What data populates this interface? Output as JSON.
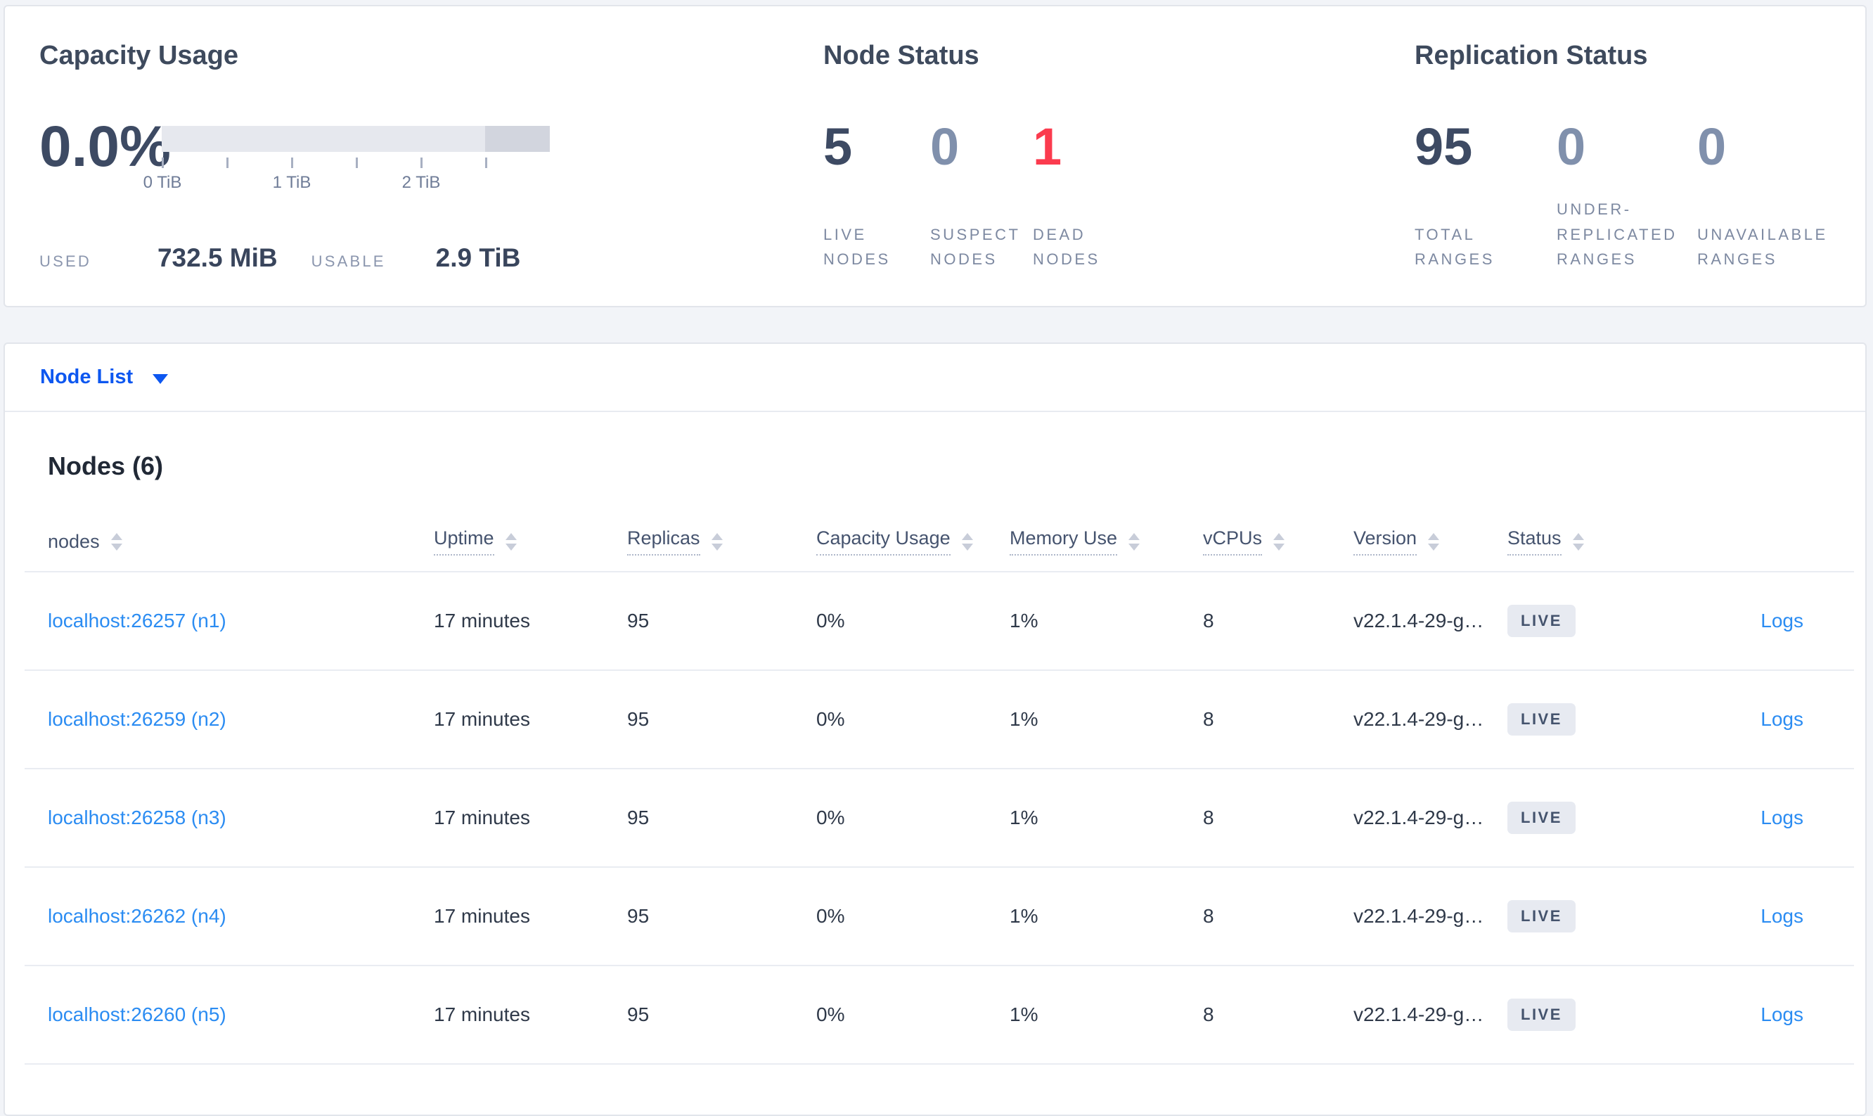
{
  "summary": {
    "capacity": {
      "title": "Capacity Usage",
      "percent": "0.0%",
      "tick_labels": [
        "0 TiB",
        "1 TiB",
        "2 TiB"
      ],
      "used_label": "USED",
      "used_value": "732.5 MiB",
      "usable_label": "USABLE",
      "usable_value": "2.9 TiB"
    },
    "node_status": {
      "title": "Node Status",
      "stats": [
        {
          "value": "5",
          "label": "LIVE NODES",
          "tone": "dark"
        },
        {
          "value": "0",
          "label": "SUSPECT NODES",
          "tone": "muted"
        },
        {
          "value": "1",
          "label": "DEAD NODES",
          "tone": "danger"
        }
      ]
    },
    "replication": {
      "title": "Replication Status",
      "stats": [
        {
          "value": "95",
          "label": "TOTAL RANGES",
          "tone": "dark"
        },
        {
          "value": "0",
          "label": "UNDER-REPLICATED RANGES",
          "tone": "muted"
        },
        {
          "value": "0",
          "label": "UNAVAILABLE RANGES",
          "tone": "muted"
        }
      ]
    }
  },
  "node_list": {
    "label": "Node List"
  },
  "nodes_section": {
    "heading": "Nodes (6)"
  },
  "table": {
    "columns": [
      {
        "key": "address",
        "label": "nodes",
        "underline": false,
        "sortable": true
      },
      {
        "key": "uptime",
        "label": "Uptime",
        "underline": true,
        "sortable": true
      },
      {
        "key": "replicas",
        "label": "Replicas",
        "underline": true,
        "sortable": true
      },
      {
        "key": "capacity",
        "label": "Capacity Usage",
        "underline": true,
        "sortable": true
      },
      {
        "key": "memory",
        "label": "Memory Use",
        "underline": true,
        "sortable": true
      },
      {
        "key": "vcpus",
        "label": "vCPUs",
        "underline": true,
        "sortable": true
      },
      {
        "key": "version",
        "label": "Version",
        "underline": true,
        "sortable": true
      },
      {
        "key": "status",
        "label": "Status",
        "underline": true,
        "sortable": true
      },
      {
        "key": "logs",
        "label": "",
        "underline": false,
        "sortable": false
      }
    ],
    "rows": [
      {
        "address": "localhost:26257 (n1)",
        "uptime": "17 minutes",
        "replicas": "95",
        "capacity": "0%",
        "memory": "1%",
        "vcpus": "8",
        "version": "v22.1.4-29-g…",
        "status": "LIVE",
        "logs": "Logs"
      },
      {
        "address": "localhost:26259 (n2)",
        "uptime": "17 minutes",
        "replicas": "95",
        "capacity": "0%",
        "memory": "1%",
        "vcpus": "8",
        "version": "v22.1.4-29-g…",
        "status": "LIVE",
        "logs": "Logs"
      },
      {
        "address": "localhost:26258 (n3)",
        "uptime": "17 minutes",
        "replicas": "95",
        "capacity": "0%",
        "memory": "1%",
        "vcpus": "8",
        "version": "v22.1.4-29-g…",
        "status": "LIVE",
        "logs": "Logs"
      },
      {
        "address": "localhost:26262 (n4)",
        "uptime": "17 minutes",
        "replicas": "95",
        "capacity": "0%",
        "memory": "1%",
        "vcpus": "8",
        "version": "v22.1.4-29-g…",
        "status": "LIVE",
        "logs": "Logs"
      },
      {
        "address": "localhost:26260 (n5)",
        "uptime": "17 minutes",
        "replicas": "95",
        "capacity": "0%",
        "memory": "1%",
        "vcpus": "8",
        "version": "v22.1.4-29-g…",
        "status": "LIVE",
        "logs": "Logs"
      }
    ]
  },
  "colors": {
    "primary_blue": "#0d57f0",
    "link_blue": "#2b8cf2",
    "danger_red": "#fb3b4e",
    "dark_number": "#3d4a63",
    "muted_number": "#8090ac",
    "badge_bg": "#e7eaf1",
    "gauge_light": "#e6e8ee",
    "gauge_dark": "#d2d5de"
  }
}
